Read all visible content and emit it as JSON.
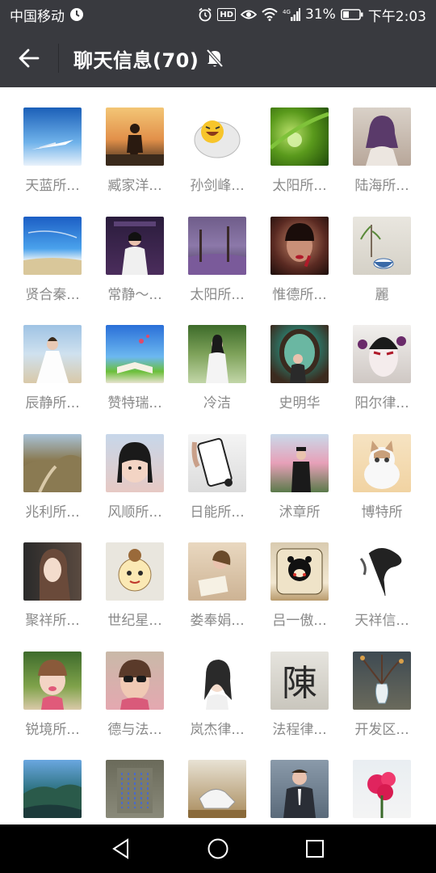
{
  "status_bar": {
    "carrier": "中国移动",
    "hd": "HD",
    "battery": "31%",
    "time": "下午2:03"
  },
  "header": {
    "title": "聊天信息(70)"
  },
  "members": [
    {
      "name": "天蓝所...",
      "bg": "linear-gradient(180deg,#1b5fb8 0%,#6fb2ea 60%,#e9f2fb 100%)",
      "fig": "plane"
    },
    {
      "name": "臧家洋...",
      "bg": "linear-gradient(180deg,#f3c676 0%,#e2904a 55%,#3a2a1c 100%)",
      "fig": "person-dark"
    },
    {
      "name": "孙剑峰...",
      "bg": "#ffffff",
      "fig": "emoji"
    },
    {
      "name": "太阳所...",
      "bg": "radial-gradient(circle at 35% 45%,#b9e06a 0%,#5a9a1c 45%,#1f4a08 100%)",
      "fig": "drop"
    },
    {
      "name": "陆海所...",
      "bg": "linear-gradient(180deg,#d9d1c8 0%,#b8a79a 100%)",
      "fig": "woman-purple"
    },
    {
      "name": "贤合秦...",
      "bg": "linear-gradient(180deg,#1c5ec4 0%,#4aa2ec 55%,#e6f0f7 75%,#d8c79a 100%)",
      "fig": "beach"
    },
    {
      "name": "常静～...",
      "bg": "linear-gradient(180deg,#2a1c3c 0%,#4b2d5c 100%)",
      "fig": "woman-stage"
    },
    {
      "name": "太阳所...",
      "bg": "linear-gradient(180deg,#6f5d8a 0%,#8c78a9 50%,#3f3352 100%)",
      "fig": "trees"
    },
    {
      "name": "惟德所...",
      "bg": "radial-gradient(circle at 50% 45%,#c98a6c 0%,#5a2a22 60%,#1b0d0a 100%)",
      "fig": "face"
    },
    {
      "name": "麗",
      "bg": "linear-gradient(180deg,#e9e6df 0%,#d5d1c7 100%)",
      "fig": "bowl"
    },
    {
      "name": "辰静所...",
      "bg": "linear-gradient(180deg,#9fc3e4 0%,#cfe1ef 50%,#d9c9a8 100%)",
      "fig": "bride"
    },
    {
      "name": "赞特瑞...",
      "bg": "linear-gradient(180deg,#2a6fd8 0%,#6cb8f0 55%,#6bbf3a 80%,#e8e3d0 100%)",
      "fig": "book"
    },
    {
      "name": "冷洁",
      "bg": "linear-gradient(180deg,#3d6b2a 0%,#7ea25a 50%,#c2d6a8 100%)",
      "fig": "woman-white"
    },
    {
      "name": "史明华",
      "bg": "radial-gradient(circle at 50% 40%,#6ab7a2 0%,#2e6b5c 45%,#3b2b1f 80%)",
      "fig": "window"
    },
    {
      "name": "阳尔律...",
      "bg": "linear-gradient(180deg,#f1efed 0%,#cfc8c4 100%)",
      "fig": "opera"
    },
    {
      "name": "兆利所...",
      "bg": "linear-gradient(180deg,#a8c2d8 0%,#8a7a52 45%,#6a5a3a 100%)",
      "fig": "hill"
    },
    {
      "name": "风顺所...",
      "bg": "linear-gradient(180deg,#c7d7ea 0%,#e7c9c4 100%)",
      "fig": "girl"
    },
    {
      "name": "日能所...",
      "bg": "linear-gradient(180deg,#f4f4f4 0%,#dcdcdc 100%)",
      "fig": "phone"
    },
    {
      "name": "沭章所",
      "bg": "linear-gradient(180deg,#c9d9ea 0%,#e7a0b8 50%,#5a7a4a 100%)",
      "fig": "man-street"
    },
    {
      "name": "博特所",
      "bg": "linear-gradient(180deg,#f6e3c2 0%,#f1d3a2 100%)",
      "fig": "cat"
    },
    {
      "name": "聚祥所...",
      "bg": "linear-gradient(90deg,#2a2a2a 0%,#5a4a40 100%)",
      "fig": "woman-hair"
    },
    {
      "name": "世纪星...",
      "bg": "#e9e6de",
      "fig": "cartoon"
    },
    {
      "name": "娄奉娟...",
      "bg": "linear-gradient(180deg,#e9d8c0 0%,#cdb394 100%)",
      "fig": "reader"
    },
    {
      "name": "吕一傲...",
      "bg": "linear-gradient(180deg,#d9cbb0 0%,#f2e7d0 70%,#b89a6c 100%)",
      "fig": "bear"
    },
    {
      "name": "天祥信...",
      "bg": "#ffffff",
      "fig": "ink"
    },
    {
      "name": "锐境所...",
      "bg": "linear-gradient(180deg,#3e6b2c 0%,#7fa24a 60%,#d9c9a8 100%)",
      "fig": "kid"
    },
    {
      "name": "德与法...",
      "bg": "linear-gradient(180deg,#c9b9a8 0%,#e4a8b0 100%)",
      "fig": "sunglasses"
    },
    {
      "name": "岚杰律...",
      "bg": "#ffffff",
      "fig": "portrait"
    },
    {
      "name": "法程律...",
      "bg": "linear-gradient(180deg,#e6e4de 0%,#c9c6bd 100%)",
      "fig": "chen"
    },
    {
      "name": "开发区...",
      "bg": "linear-gradient(180deg,#3e4a52 0%,#6a6a5c 100%)",
      "fig": "vase"
    },
    {
      "name": "",
      "bg": "linear-gradient(180deg,#6aa7e0 0%,#2a6f7a 55%,#1c3a3a 100%)",
      "fig": "coast"
    },
    {
      "name": "",
      "bg": "linear-gradient(180deg,#6a6a5a 0%,#8a8a7a 100%)",
      "fig": "stele"
    },
    {
      "name": "",
      "bg": "linear-gradient(180deg,#e8e2d4 0%,#a88a5a 100%)",
      "fig": "shoe"
    },
    {
      "name": "",
      "bg": "linear-gradient(180deg,#8a9aaa 0%,#5a6a7a 100%)",
      "fig": "suit"
    },
    {
      "name": "",
      "bg": "linear-gradient(180deg,#e9eef2 0%,#f4f4f4 100%)",
      "fig": "flower"
    }
  ]
}
